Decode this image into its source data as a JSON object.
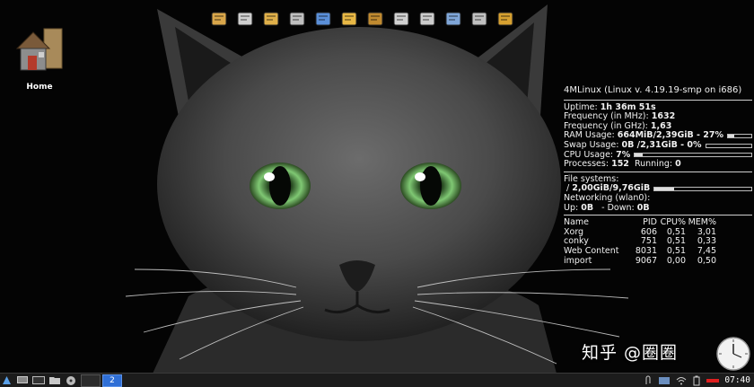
{
  "desktop": {
    "home_icon_label": "Home"
  },
  "dock": {
    "launchers": [
      {
        "name": "file-manager-icon",
        "color": "#d9a64a"
      },
      {
        "name": "terminal-icon",
        "color": "#cfcfcf"
      },
      {
        "name": "text-editor-icon",
        "color": "#e0b04a"
      },
      {
        "name": "calculator-icon",
        "color": "#bfbfbf"
      },
      {
        "name": "browser-globe-icon",
        "color": "#5a8fd8"
      },
      {
        "name": "mail-icon",
        "color": "#e8b845"
      },
      {
        "name": "headphones-icon",
        "color": "#c08a30"
      },
      {
        "name": "video-reel-icon",
        "color": "#d0d0d0"
      },
      {
        "name": "camera-icon",
        "color": "#cccccc"
      },
      {
        "name": "network-icon",
        "color": "#7fa6d8"
      },
      {
        "name": "settings-icon",
        "color": "#c0c0c0"
      },
      {
        "name": "tools-icon",
        "color": "#d6a030"
      }
    ]
  },
  "conky": {
    "title": "4MLinux (Linux v. 4.19.19-smp on i686)",
    "uptime_label": "Uptime:",
    "uptime_value": "1h 36m 51s",
    "freq_mhz_label": "Frequency (in MHz):",
    "freq_mhz_value": "1632",
    "freq_ghz_label": "Frequency (in GHz):",
    "freq_ghz_value": "1,63",
    "ram_label": "RAM Usage:",
    "ram_value": "664MiB/2,39GiB - 27%",
    "ram_fraction": 0.27,
    "swap_label": "Swap Usage:",
    "swap_value": "0B  /2,31GiB - 0%",
    "swap_fraction": 0.0,
    "cpu_label": "CPU Usage:",
    "cpu_value": "7%",
    "cpu_fraction": 0.07,
    "processes_label": "Processes:",
    "processes_value": "152",
    "running_label": "Running:",
    "running_value": "0",
    "fs_label": "File systems:",
    "fs_root": "/",
    "fs_value": "2,00GiB/9,76GiB",
    "fs_fraction": 0.205,
    "net_label": "Networking (wlan0):",
    "up_label": "Up:",
    "up_value": "0B",
    "down_label": "- Down:",
    "down_value": "0B",
    "proc_headers": [
      "Name",
      "PID",
      "CPU%",
      "MEM%"
    ],
    "procs": [
      {
        "name": "Xorg",
        "pid": "606",
        "cpu": "0,51",
        "mem": "3,01"
      },
      {
        "name": "conky",
        "pid": "751",
        "cpu": "0,51",
        "mem": "0,33"
      },
      {
        "name": "Web Content",
        "pid": "8031",
        "cpu": "0,51",
        "mem": "7,45"
      },
      {
        "name": "import",
        "pid": "9067",
        "cpu": "0,00",
        "mem": "0,50"
      }
    ]
  },
  "watermark": "知乎 @圈圈",
  "taskbar": {
    "workspace_labels": [
      "",
      "2"
    ],
    "active_workspace": 1,
    "clock": "07:40"
  },
  "colors": {
    "workspace_active": "#2f6fd6",
    "cat_eye": "#8fd38a",
    "tray_indicator": "#e02020"
  }
}
